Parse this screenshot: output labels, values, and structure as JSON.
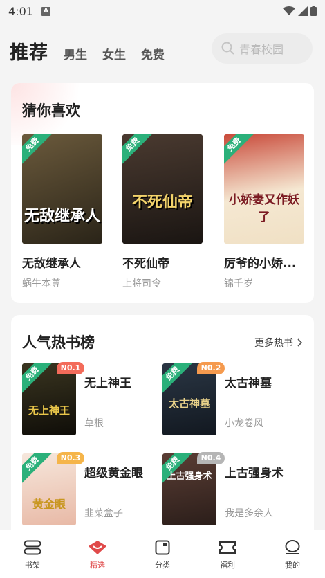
{
  "status": {
    "time": "4:01",
    "a_badge": "A"
  },
  "nav": {
    "tabs": [
      "推荐",
      "男生",
      "女生",
      "免费"
    ],
    "search_placeholder": "青春校园"
  },
  "guess": {
    "title": "猜你喜欢",
    "books": [
      {
        "name": "无敌继承人",
        "author": "蜗牛本尊",
        "tag": "免费",
        "cover_text": "无敌继承人",
        "cover_color": "#3b3324"
      },
      {
        "name": "不死仙帝",
        "author": "上将司令",
        "tag": "免费",
        "cover_text": "不死仙帝",
        "cover_color": "#2a1f1a"
      },
      {
        "name": "厉爷的小娇...",
        "author": "锦千岁",
        "tag": "免费",
        "cover_text": "小娇妻又作妖了",
        "cover_color": "#f2e6d0"
      }
    ]
  },
  "hot": {
    "title": "人气热书榜",
    "more": "更多热书",
    "items": [
      {
        "rank": "N0.1",
        "name": "无上神王",
        "author": "草根",
        "tag": "免费",
        "cover_text": "无上神王",
        "cover_color": "#1c1a12",
        "badge_color": "#f36b5a"
      },
      {
        "rank": "N0.2",
        "name": "太古神墓",
        "author": "小龙卷风",
        "tag": "免费",
        "cover_text": "太古神墓",
        "cover_color": "#1d2530",
        "badge_color": "#f59a4e"
      },
      {
        "rank": "N0.3",
        "name": "超级黄金眼",
        "author": "韭菜盒子",
        "tag": "免费",
        "cover_text": "黄金眼",
        "cover_color": "#f4ddd0",
        "badge_color": "#f5b54a"
      },
      {
        "rank": "N0.4",
        "name": "上古强身术",
        "author": "我是多余人",
        "tag": "免费",
        "cover_text": "上古强身术",
        "cover_color": "#3a2a26",
        "badge_color": "#b5b5b5"
      }
    ]
  },
  "bottom": {
    "items": [
      {
        "label": "书架",
        "icon": "bookshelf-icon"
      },
      {
        "label": "精选",
        "icon": "featured-icon"
      },
      {
        "label": "分类",
        "icon": "category-icon"
      },
      {
        "label": "福利",
        "icon": "welfare-icon"
      },
      {
        "label": "我的",
        "icon": "profile-icon"
      }
    ],
    "active_color": "#e04a4a"
  }
}
